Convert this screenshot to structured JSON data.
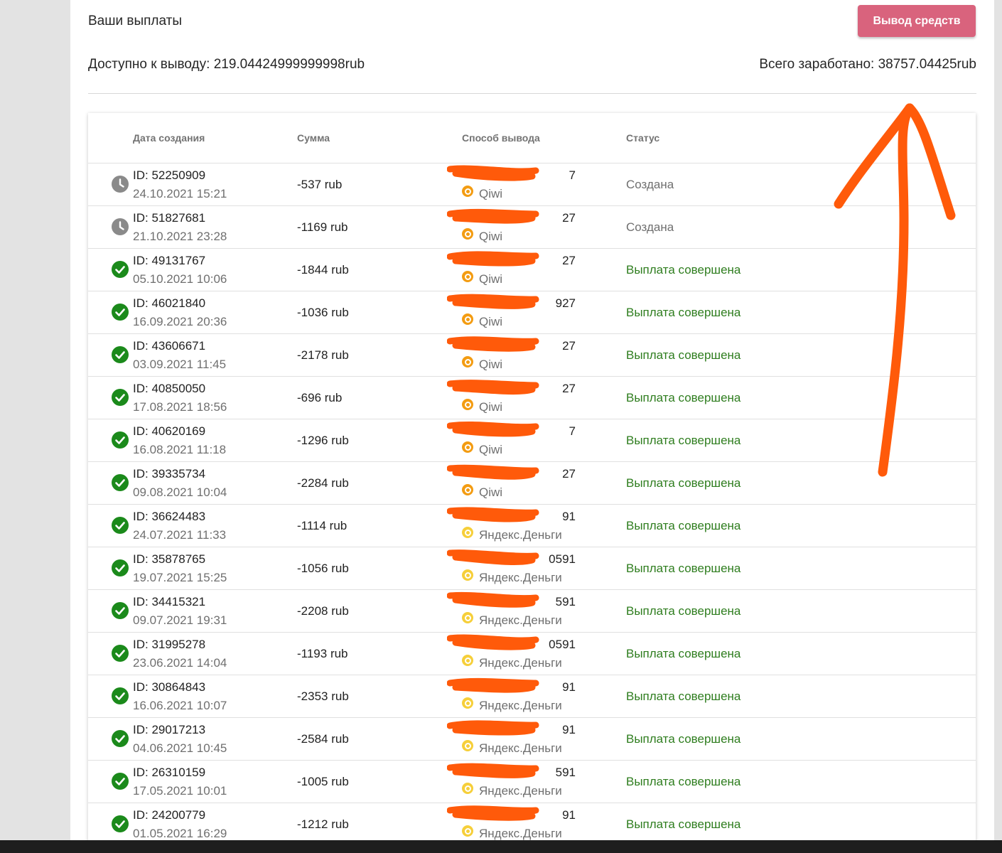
{
  "header": {
    "title": "Ваши выплаты",
    "withdraw_button": "Вывод средств",
    "available": "Доступно к выводу: 219.04424999999998rub",
    "total_earned": "Всего заработано: 38757.04425rub"
  },
  "table": {
    "columns": [
      "Дата создания",
      "Сумма",
      "Способ вывода",
      "Статус"
    ],
    "rows": [
      {
        "id": "ID: 52250909",
        "date": "24.10.2021 15:21",
        "amount": "-537 rub",
        "account": "7",
        "method": "Qiwi",
        "method_type": "qiwi",
        "status": "Создана",
        "state": "created"
      },
      {
        "id": "ID: 51827681",
        "date": "21.10.2021 23:28",
        "amount": "-1169 rub",
        "account": "27",
        "method": "Qiwi",
        "method_type": "qiwi",
        "status": "Создана",
        "state": "created"
      },
      {
        "id": "ID: 49131767",
        "date": "05.10.2021 10:06",
        "amount": "-1844 rub",
        "account": "27",
        "method": "Qiwi",
        "method_type": "qiwi",
        "status": "Выплата совершена",
        "state": "paid"
      },
      {
        "id": "ID: 46021840",
        "date": "16.09.2021 20:36",
        "amount": "-1036 rub",
        "account": "927",
        "method": "Qiwi",
        "method_type": "qiwi",
        "status": "Выплата совершена",
        "state": "paid"
      },
      {
        "id": "ID: 43606671",
        "date": "03.09.2021 11:45",
        "amount": "-2178 rub",
        "account": "27",
        "method": "Qiwi",
        "method_type": "qiwi",
        "status": "Выплата совершена",
        "state": "paid"
      },
      {
        "id": "ID: 40850050",
        "date": "17.08.2021 18:56",
        "amount": "-696 rub",
        "account": "27",
        "method": "Qiwi",
        "method_type": "qiwi",
        "status": "Выплата совершена",
        "state": "paid"
      },
      {
        "id": "ID: 40620169",
        "date": "16.08.2021 11:18",
        "amount": "-1296 rub",
        "account": "7",
        "method": "Qiwi",
        "method_type": "qiwi",
        "status": "Выплата совершена",
        "state": "paid"
      },
      {
        "id": "ID: 39335734",
        "date": "09.08.2021 10:04",
        "amount": "-2284 rub",
        "account": "27",
        "method": "Qiwi",
        "method_type": "qiwi",
        "status": "Выплата совершена",
        "state": "paid"
      },
      {
        "id": "ID: 36624483",
        "date": "24.07.2021 11:33",
        "amount": "-1114 rub",
        "account": "91",
        "method": "Яндекс.Деньги",
        "method_type": "yandex",
        "status": "Выплата совершена",
        "state": "paid"
      },
      {
        "id": "ID: 35878765",
        "date": "19.07.2021 15:25",
        "amount": "-1056 rub",
        "account": "0591",
        "method": "Яндекс.Деньги",
        "method_type": "yandex",
        "status": "Выплата совершена",
        "state": "paid"
      },
      {
        "id": "ID: 34415321",
        "date": "09.07.2021 19:31",
        "amount": "-2208 rub",
        "account": "591",
        "method": "Яндекс.Деньги",
        "method_type": "yandex",
        "status": "Выплата совершена",
        "state": "paid"
      },
      {
        "id": "ID: 31995278",
        "date": "23.06.2021 14:04",
        "amount": "-1193 rub",
        "account": "0591",
        "method": "Яндекс.Деньги",
        "method_type": "yandex",
        "status": "Выплата совершена",
        "state": "paid"
      },
      {
        "id": "ID: 30864843",
        "date": "16.06.2021 10:07",
        "amount": "-2353 rub",
        "account": "91",
        "method": "Яндекс.Деньги",
        "method_type": "yandex",
        "status": "Выплата совершена",
        "state": "paid"
      },
      {
        "id": "ID: 29017213",
        "date": "04.06.2021 10:45",
        "amount": "-2584 rub",
        "account": "91",
        "method": "Яндекс.Деньги",
        "method_type": "yandex",
        "status": "Выплата совершена",
        "state": "paid"
      },
      {
        "id": "ID: 26310159",
        "date": "17.05.2021 10:01",
        "amount": "-1005 rub",
        "account": "591",
        "method": "Яндекс.Деньги",
        "method_type": "yandex",
        "status": "Выплата совершена",
        "state": "paid"
      },
      {
        "id": "ID: 24200779",
        "date": "01.05.2021 16:29",
        "amount": "-1212 rub",
        "account": "91",
        "method": "Яндекс.Деньги",
        "method_type": "yandex",
        "status": "Выплата совершена",
        "state": "paid"
      }
    ]
  },
  "colors": {
    "button": "#d9637d",
    "paid_status": "#2e7d1e",
    "check_icon": "#1b8a1b",
    "clock_icon": "#8a8a8a",
    "annotation": "#ff5a0a"
  },
  "icons": {
    "created": "clock-icon",
    "paid": "check-circle-icon"
  }
}
